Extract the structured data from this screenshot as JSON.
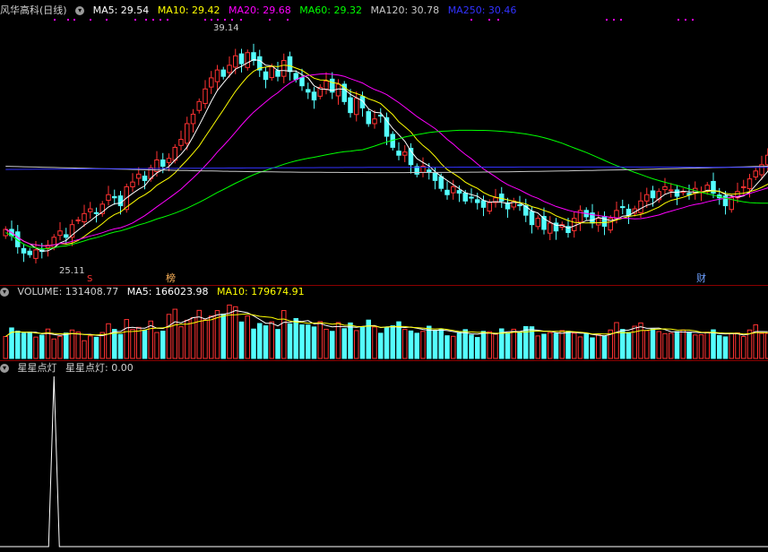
{
  "price_header": {
    "title": "风华高科(日线)",
    "ma5": "MA5: 29.54",
    "ma10": "MA10: 29.42",
    "ma20": "MA20: 29.68",
    "ma60": "MA60: 29.32",
    "ma120": "MA120: 30.78",
    "ma250": "MA250: 30.46"
  },
  "volume_header": {
    "volume": "VOLUME: 131408.77",
    "ma5": "MA5: 166023.98",
    "ma10": "MA10: 179674.91"
  },
  "indicator_header": {
    "name": "星星点灯",
    "value": "星星点灯: 0.00"
  },
  "markers": {
    "low": "25.11",
    "high": "39.14",
    "s": "S",
    "bang": "榜",
    "cai": "财"
  },
  "colors": {
    "up": "#ff3232",
    "down": "#54ffff",
    "ma5": "#ffffff",
    "ma10": "#ffff00",
    "ma20": "#ff00ff",
    "ma60": "#00ff00",
    "ma120": "#c8c8c8",
    "ma250": "#3232ff"
  },
  "chart_data": {
    "type": "candlestick",
    "price_range": [
      24.4,
      40.3
    ],
    "volume_range": [
      0,
      310000
    ],
    "indicator_range": [
      0,
      1
    ],
    "closes": [
      26.9,
      26.5,
      25.8,
      25.4,
      25.3,
      25.6,
      25.5,
      25.9,
      26.4,
      26.8,
      26.4,
      27.2,
      27.5,
      27.9,
      28.2,
      27.9,
      28.5,
      29.1,
      28.9,
      28.4,
      29.6,
      29.9,
      30.4,
      30.0,
      30.8,
      31.3,
      30.9,
      31.4,
      32.1,
      32.6,
      33.6,
      34.2,
      35.0,
      35.8,
      36.5,
      37.0,
      36.6,
      37.3,
      37.9,
      37.4,
      38.1,
      37.6,
      37.0,
      36.4,
      37.2,
      36.6,
      37.6,
      36.9,
      36.4,
      36.0,
      35.6,
      35.1,
      35.9,
      36.3,
      35.6,
      36.1,
      35.0,
      34.3,
      35.2,
      34.6,
      33.6,
      33.9,
      34.1,
      32.8,
      32.1,
      31.6,
      31.8,
      31.0,
      30.4,
      30.9,
      30.5,
      30.0,
      29.5,
      29.1,
      29.6,
      29.2,
      28.7,
      28.9,
      28.6,
      28.3,
      28.6,
      28.9,
      28.7,
      28.2,
      28.7,
      28.4,
      27.8,
      27.2,
      27.6,
      26.9,
      27.3,
      26.8,
      27.2,
      26.7,
      27.6,
      28.1,
      27.7,
      27.3,
      27.6,
      27.1,
      27.6,
      28.1,
      28.3,
      27.8,
      28.2,
      28.7,
      29.1,
      28.9,
      29.3,
      29.6,
      29.4,
      29.0,
      29.3,
      29.1,
      29.5,
      29.3,
      29.7,
      29.2,
      28.9,
      28.4,
      28.9,
      29.3,
      29.6,
      30.1,
      30.6,
      31.0,
      31.6,
      31.9,
      31.3
    ],
    "volumes": [
      115000,
      160000,
      143000,
      132000,
      138000,
      112000,
      122000,
      154000,
      102000,
      116000,
      133000,
      149000,
      138000,
      93000,
      118000,
      111000,
      136000,
      182000,
      152000,
      126000,
      204000,
      152000,
      163000,
      147000,
      196000,
      136000,
      143000,
      231000,
      258000,
      166000,
      200000,
      214000,
      252000,
      202000,
      222000,
      251000,
      232000,
      280000,
      271000,
      191000,
      223000,
      154000,
      183000,
      171000,
      192000,
      152000,
      251000,
      181000,
      209000,
      176000,
      175000,
      165000,
      193000,
      153000,
      142000,
      188000,
      156000,
      186000,
      146000,
      165000,
      201000,
      165000,
      132000,
      163000,
      171000,
      192000,
      152000,
      144000,
      132000,
      142000,
      169000,
      148000,
      153000,
      119000,
      116000,
      137000,
      151000,
      123000,
      110000,
      142000,
      140000,
      127000,
      155000,
      133000,
      153000,
      136000,
      167000,
      166000,
      118000,
      127000,
      135000,
      131000,
      146000,
      142000,
      132000,
      113000,
      131000,
      108000,
      125000,
      117000,
      149000,
      188000,
      152000,
      136000,
      169000,
      186000,
      146000,
      154000,
      141000,
      130000,
      132000,
      141000,
      149000,
      138000,
      123000,
      124000,
      137000,
      150000,
      120000,
      113000,
      130000,
      134000,
      115000,
      149000,
      176000,
      131000,
      131000
    ],
    "indicator_peak_index": 8
  }
}
